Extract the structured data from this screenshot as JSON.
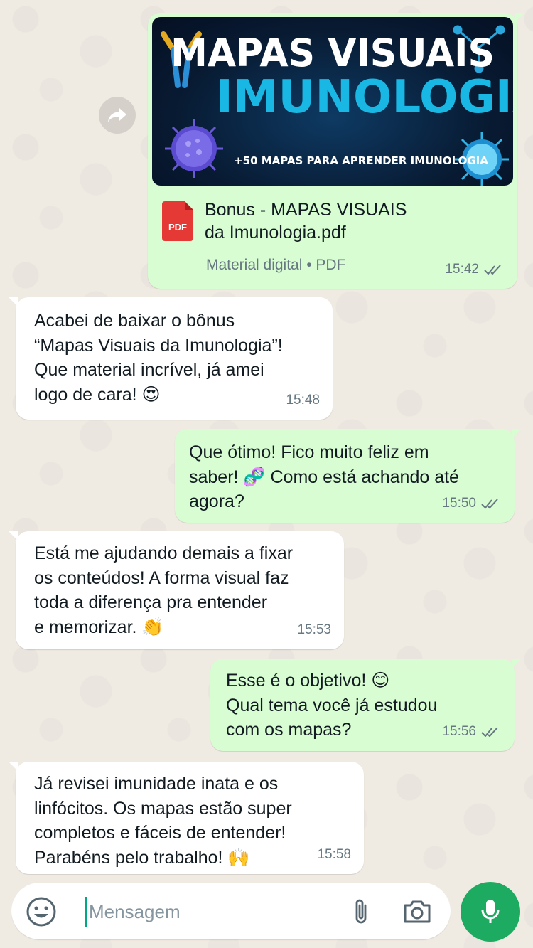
{
  "document_message": {
    "banner": {
      "title_line1": "MAPAS VISUAIS",
      "title_line2": "IMUNOLOGIA",
      "subtitle": "+50 MAPAS PARA APRENDER IMUNOLOGIA"
    },
    "file_icon_label": "PDF",
    "file_name": "Bonus - MAPAS VISUAIS\nda Imunologia.pdf",
    "file_info": "Material digital • PDF",
    "time": "15:42",
    "status": "read"
  },
  "messages": [
    {
      "direction": "in",
      "text": "Acabei de baixar o bônus\n“Mapas Visuais da Imunologia”!\nQue material incrível, já amei\nlogo de cara! 😍",
      "time": "15:48"
    },
    {
      "direction": "out",
      "text": "Que ótimo! Fico muito feliz em\nsaber! 🧬 Como está achando até\nagora?",
      "time": "15:50",
      "status": "read"
    },
    {
      "direction": "in",
      "text": "Está me ajudando demais a fixar\nos conteúdos! A forma visual faz\ntoda a diferença pra entender\ne memorizar. 👏",
      "time": "15:53"
    },
    {
      "direction": "out",
      "text": "Esse é o objetivo! 😊\nQual tema você já estudou\ncom os mapas?",
      "time": "15:56",
      "status": "read"
    },
    {
      "direction": "in",
      "text": "Já revisei imunidade inata e os\nlinfócitos. Os mapas estão super\ncompletos e fáceis de entender!\nParabéns pelo trabalho! 🙌",
      "time": "15:58"
    }
  ],
  "input": {
    "placeholder": "Mensagem",
    "value": ""
  },
  "icons": {
    "forward": "forward-icon",
    "emoji": "emoji-icon",
    "attach": "paperclip-icon",
    "camera": "camera-icon",
    "mic": "mic-icon",
    "read_receipt": "double-check-icon"
  },
  "colors": {
    "background": "#efeae2",
    "incoming_bubble": "#ffffff",
    "outgoing_bubble": "#d9fdd3",
    "accent": "#1daa61",
    "read_ticks": "#667781"
  }
}
